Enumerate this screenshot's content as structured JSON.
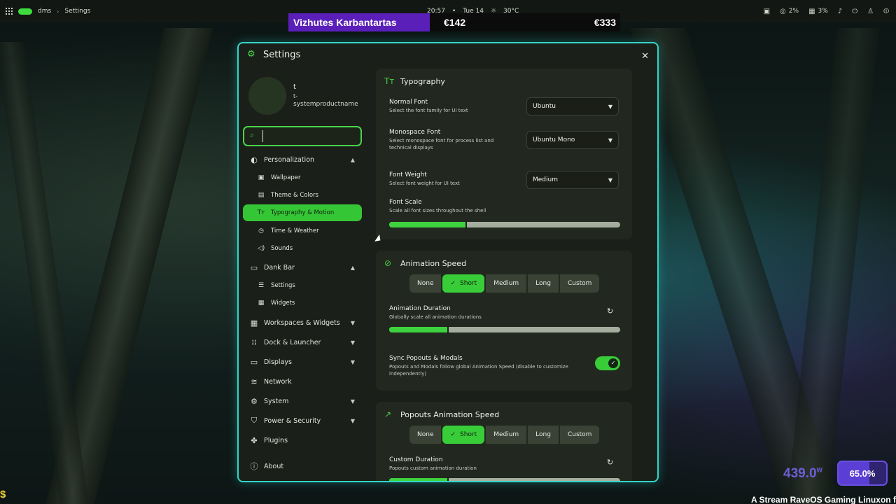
{
  "topbar": {
    "workspace": "dms",
    "breadcrumb": "Settings",
    "time": "20:57",
    "date": "Tue 14",
    "weather": "30°C",
    "cpu": "2%",
    "ram": "3%"
  },
  "stream": {
    "name": "Vizhutes Karbantartas",
    "amount1": "€142",
    "amount2": "€333",
    "watts": "439.0",
    "watts_unit": "W",
    "percent": "65.0%",
    "ticker": "A Stream RaveOS Gaming Linuxon fut"
  },
  "window": {
    "title": "Settings"
  },
  "user": {
    "name": "t",
    "host_line1": "t-",
    "host_line2": "systemproductname"
  },
  "search": {
    "placeholder": "",
    "value": ""
  },
  "sidebar": {
    "items": [
      {
        "label": "Personalization"
      },
      {
        "label": "Wallpaper"
      },
      {
        "label": "Theme & Colors"
      },
      {
        "label": "Typography & Motion"
      },
      {
        "label": "Time & Weather"
      },
      {
        "label": "Sounds"
      },
      {
        "label": "Dank Bar"
      },
      {
        "label": "Settings"
      },
      {
        "label": "Widgets"
      },
      {
        "label": "Workspaces & Widgets"
      },
      {
        "label": "Dock & Launcher"
      },
      {
        "label": "Displays"
      },
      {
        "label": "Network"
      },
      {
        "label": "System"
      },
      {
        "label": "Power & Security"
      },
      {
        "label": "Plugins"
      },
      {
        "label": "About"
      }
    ]
  },
  "typography": {
    "title": "Typography",
    "normal_font_label": "Normal Font",
    "normal_font_desc": "Select the font family for UI text",
    "normal_font_value": "Ubuntu",
    "mono_font_label": "Monospace Font",
    "mono_font_desc": "Select monospace font for process list and technical displays",
    "mono_font_value": "Ubuntu Mono",
    "weight_label": "Font Weight",
    "weight_desc": "Select font weight for UI text",
    "weight_value": "Medium",
    "scale_label": "Font Scale",
    "scale_desc": "Scale all font sizes throughout the shell",
    "scale_fraction": 0.33
  },
  "animation": {
    "title": "Animation Speed",
    "options": [
      "None",
      "Short",
      "Medium",
      "Long",
      "Custom"
    ],
    "selected_check": "✓",
    "duration_label": "Animation Duration",
    "duration_desc": "Globally scale all animation durations",
    "duration_fraction": 0.25,
    "sync_label": "Sync Popouts & Modals",
    "sync_desc": "Popouts and Modals follow global Animation Speed (disable to customize independently)",
    "sync_on": true
  },
  "popouts": {
    "title": "Popouts Animation Speed",
    "options": [
      "None",
      "Short",
      "Medium",
      "Long",
      "Custom"
    ],
    "custom_label": "Custom Duration",
    "custom_desc": "Popouts custom animation duration",
    "custom_fraction": 0.25
  },
  "colors": {
    "accent": "#3ed23e",
    "border": "#33d6c6",
    "stream_purple": "#5a1fb8"
  }
}
